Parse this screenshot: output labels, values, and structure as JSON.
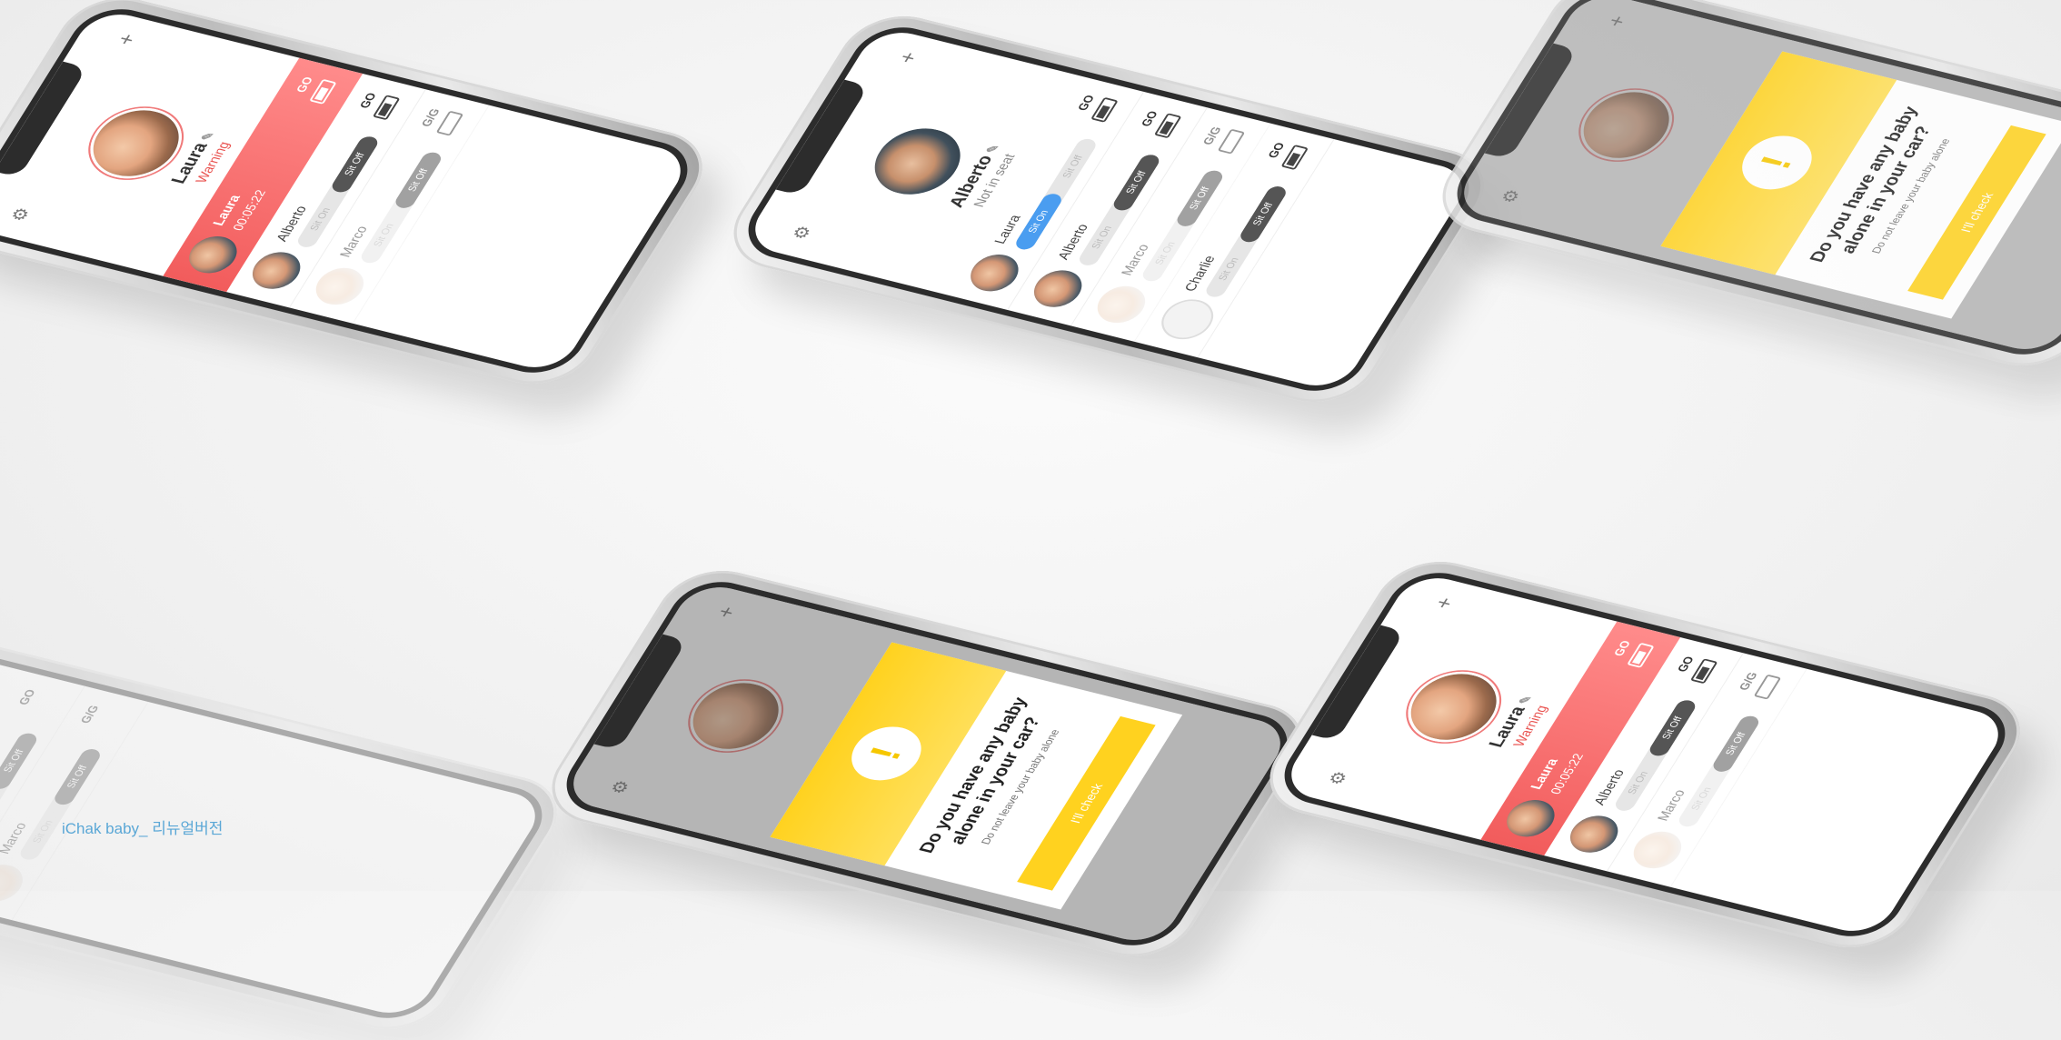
{
  "caption": "iChak baby_ 리뉴얼버전",
  "phones": {
    "laura": {
      "name": "Laura",
      "status": "Warning",
      "alert_row": {
        "name": "Laura",
        "time": "00:05:22",
        "signal": "GO"
      },
      "rows": [
        {
          "name": "Alberto",
          "on": "Sit On",
          "off": "Sit Off",
          "signal": "GO"
        },
        {
          "name": "Marco",
          "on": "Sit On",
          "off": "Sit Off",
          "signal": "G/G"
        }
      ]
    },
    "alberto": {
      "name": "Alberto",
      "status": "Not in seat",
      "rows": [
        {
          "name": "Laura",
          "on": "Sit On",
          "off": "Sit Off",
          "signal": "GO"
        },
        {
          "name": "Alberto",
          "on": "Sit On",
          "off": "Sit Off",
          "signal": "GO"
        },
        {
          "name": "Marco",
          "on": "Sit On",
          "off": "Sit Off",
          "signal": "G/G"
        },
        {
          "name": "Charlie",
          "on": "Sit On",
          "off": "Sit Off",
          "signal": "GO"
        }
      ]
    },
    "modal": {
      "title": "Do you have any baby alone in your car?",
      "subtitle": "Do not leave your baby alone",
      "button": "I'll check",
      "badge": "!"
    },
    "icons": {
      "gear": "gear-icon",
      "plus": "plus-icon",
      "pen": "pen-icon"
    }
  }
}
